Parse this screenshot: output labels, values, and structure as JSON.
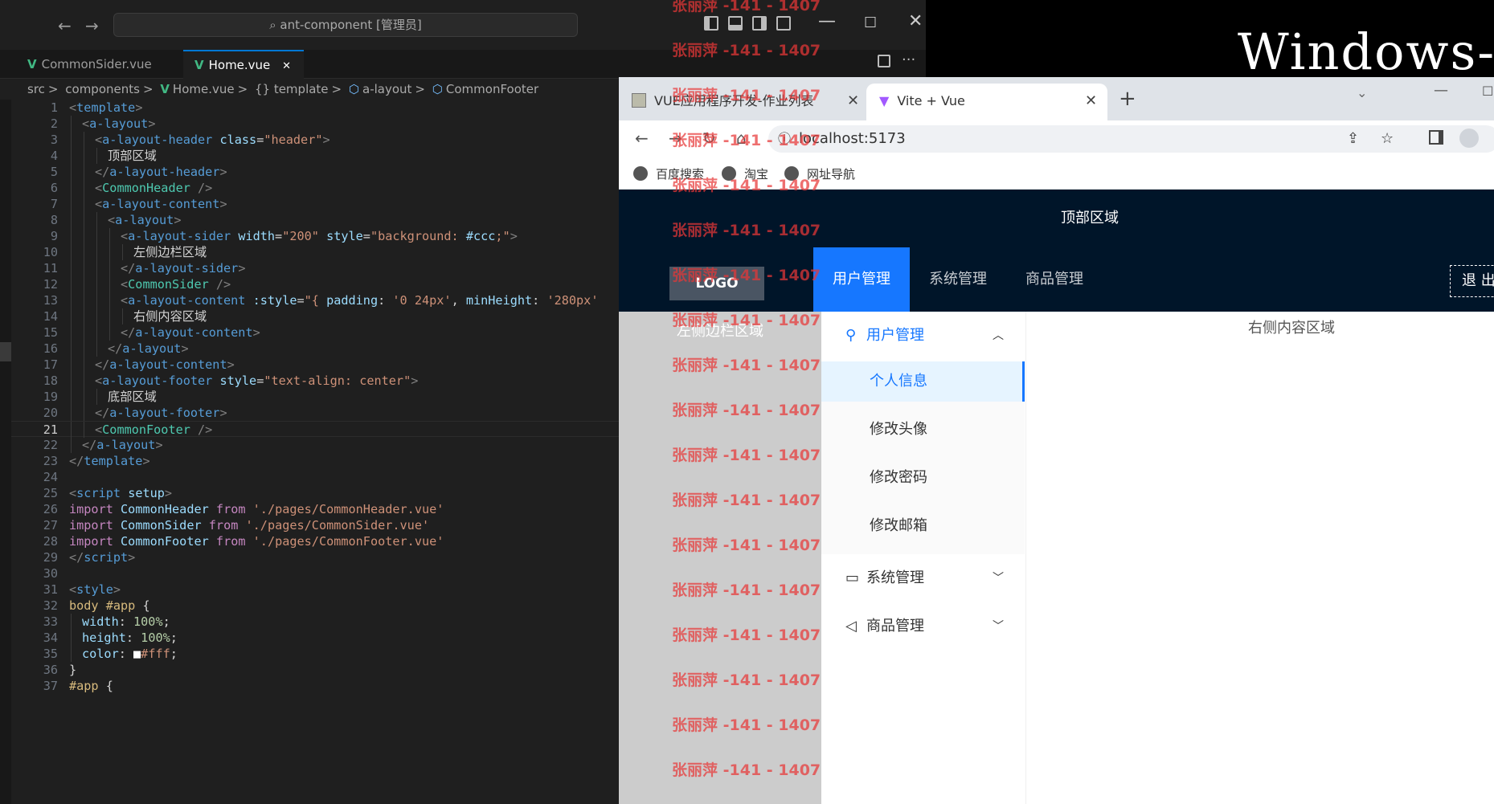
{
  "background": {
    "windows_text": "Windows-"
  },
  "vscode": {
    "search": "ant-component [管理员]",
    "tabs": [
      {
        "label": "CommonSider.vue",
        "active": false
      },
      {
        "label": "Home.vue",
        "active": true
      }
    ],
    "tab_close": "✕",
    "breadcrumb": [
      "src",
      "components",
      "Home.vue",
      "{} template",
      "a-layout",
      "CommonFooter"
    ],
    "breadcrumb_sep": ">",
    "current_line": 21,
    "lines": [
      {
        "n": "1",
        "indent": 0,
        "t": [
          [
            "t",
            "<"
          ],
          [
            "tag",
            "template"
          ],
          [
            "t",
            ">"
          ]
        ]
      },
      {
        "n": "2",
        "indent": 1,
        "t": [
          [
            "t",
            "<"
          ],
          [
            "tag",
            "a-layout"
          ],
          [
            "t",
            ">"
          ]
        ]
      },
      {
        "n": "3",
        "indent": 2,
        "t": [
          [
            "t",
            "<"
          ],
          [
            "tag",
            "a-layout-header"
          ],
          [
            "p",
            " "
          ],
          [
            "attr",
            "class"
          ],
          [
            "p",
            "="
          ],
          [
            "str",
            "\"header\""
          ],
          [
            "t",
            ">"
          ]
        ]
      },
      {
        "n": "4",
        "indent": 3,
        "t": [
          [
            "p",
            "顶部区域"
          ]
        ]
      },
      {
        "n": "5",
        "indent": 2,
        "t": [
          [
            "t",
            "</"
          ],
          [
            "tag",
            "a-layout-header"
          ],
          [
            "t",
            ">"
          ]
        ]
      },
      {
        "n": "6",
        "indent": 2,
        "t": [
          [
            "t",
            "<"
          ],
          [
            "comp",
            "CommonHeader"
          ],
          [
            "t",
            " />"
          ]
        ]
      },
      {
        "n": "7",
        "indent": 2,
        "t": [
          [
            "t",
            "<"
          ],
          [
            "tag",
            "a-layout-content"
          ],
          [
            "t",
            ">"
          ]
        ]
      },
      {
        "n": "8",
        "indent": 3,
        "t": [
          [
            "t",
            "<"
          ],
          [
            "tag",
            "a-layout"
          ],
          [
            "t",
            ">"
          ]
        ]
      },
      {
        "n": "9",
        "indent": 4,
        "t": [
          [
            "t",
            "<"
          ],
          [
            "tag",
            "a-layout-sider"
          ],
          [
            "p",
            " "
          ],
          [
            "attr",
            "width"
          ],
          [
            "p",
            "="
          ],
          [
            "str",
            "\"200\""
          ],
          [
            "p",
            " "
          ],
          [
            "attr",
            "style"
          ],
          [
            "p",
            "="
          ],
          [
            "str",
            "\"background: "
          ],
          [
            "attr",
            "#ccc"
          ],
          [
            "str",
            ";\""
          ],
          [
            "t",
            ">"
          ]
        ]
      },
      {
        "n": "10",
        "indent": 5,
        "t": [
          [
            "p",
            "左侧边栏区域"
          ]
        ]
      },
      {
        "n": "11",
        "indent": 4,
        "t": [
          [
            "t",
            "</"
          ],
          [
            "tag",
            "a-layout-sider"
          ],
          [
            "t",
            ">"
          ]
        ]
      },
      {
        "n": "12",
        "indent": 4,
        "t": [
          [
            "t",
            "<"
          ],
          [
            "comp",
            "CommonSider"
          ],
          [
            "t",
            " />"
          ]
        ]
      },
      {
        "n": "13",
        "indent": 4,
        "t": [
          [
            "t",
            "<"
          ],
          [
            "tag",
            "a-layout-content"
          ],
          [
            "p",
            " "
          ],
          [
            "attr",
            ":style"
          ],
          [
            "p",
            "="
          ],
          [
            "str",
            "\"{ "
          ],
          [
            "attr",
            "padding"
          ],
          [
            "p",
            ": "
          ],
          [
            "str",
            "'0 24px'"
          ],
          [
            "p",
            ", "
          ],
          [
            "attr",
            "minHeight"
          ],
          [
            "p",
            ": "
          ],
          [
            "str",
            "'280px'"
          ]
        ]
      },
      {
        "n": "14",
        "indent": 5,
        "t": [
          [
            "p",
            "右侧内容区域"
          ]
        ]
      },
      {
        "n": "15",
        "indent": 4,
        "t": [
          [
            "t",
            "</"
          ],
          [
            "tag",
            "a-layout-content"
          ],
          [
            "t",
            ">"
          ]
        ]
      },
      {
        "n": "16",
        "indent": 3,
        "t": [
          [
            "t",
            "</"
          ],
          [
            "tag",
            "a-layout"
          ],
          [
            "t",
            ">"
          ]
        ]
      },
      {
        "n": "17",
        "indent": 2,
        "t": [
          [
            "t",
            "</"
          ],
          [
            "tag",
            "a-layout-content"
          ],
          [
            "t",
            ">"
          ]
        ]
      },
      {
        "n": "18",
        "indent": 2,
        "t": [
          [
            "t",
            "<"
          ],
          [
            "tag",
            "a-layout-footer"
          ],
          [
            "p",
            " "
          ],
          [
            "attr",
            "style"
          ],
          [
            "p",
            "="
          ],
          [
            "str",
            "\"text-align: "
          ],
          [
            "str",
            "center\""
          ],
          [
            "t",
            ">"
          ]
        ]
      },
      {
        "n": "19",
        "indent": 3,
        "t": [
          [
            "p",
            "底部区域"
          ]
        ]
      },
      {
        "n": "20",
        "indent": 2,
        "t": [
          [
            "t",
            "</"
          ],
          [
            "tag",
            "a-layout-footer"
          ],
          [
            "t",
            ">"
          ]
        ]
      },
      {
        "n": "21",
        "indent": 2,
        "t": [
          [
            "t",
            "<"
          ],
          [
            "comp",
            "CommonFooter"
          ],
          [
            "t",
            " />"
          ]
        ]
      },
      {
        "n": "22",
        "indent": 1,
        "t": [
          [
            "t",
            "</"
          ],
          [
            "tag",
            "a-layout"
          ],
          [
            "t",
            ">"
          ]
        ]
      },
      {
        "n": "23",
        "indent": 0,
        "t": [
          [
            "t",
            "</"
          ],
          [
            "tag",
            "template"
          ],
          [
            "t",
            ">"
          ]
        ]
      },
      {
        "n": "24",
        "indent": 0,
        "t": []
      },
      {
        "n": "25",
        "indent": 0,
        "t": [
          [
            "t",
            "<"
          ],
          [
            "tag",
            "script"
          ],
          [
            "p",
            " "
          ],
          [
            "attr",
            "setup"
          ],
          [
            "t",
            ">"
          ]
        ]
      },
      {
        "n": "26",
        "indent": 0,
        "t": [
          [
            "kw",
            "import"
          ],
          [
            "p",
            " "
          ],
          [
            "id",
            "CommonHeader"
          ],
          [
            "p",
            " "
          ],
          [
            "kw",
            "from"
          ],
          [
            "p",
            " "
          ],
          [
            "str",
            "'./pages/CommonHeader.vue'"
          ]
        ]
      },
      {
        "n": "27",
        "indent": 0,
        "t": [
          [
            "kw",
            "import"
          ],
          [
            "p",
            " "
          ],
          [
            "id",
            "CommonSider"
          ],
          [
            "p",
            " "
          ],
          [
            "kw",
            "from"
          ],
          [
            "p",
            " "
          ],
          [
            "str",
            "'./pages/CommonSider.vue'"
          ]
        ]
      },
      {
        "n": "28",
        "indent": 0,
        "t": [
          [
            "kw",
            "import"
          ],
          [
            "p",
            " "
          ],
          [
            "id",
            "CommonFooter"
          ],
          [
            "p",
            " "
          ],
          [
            "kw",
            "from"
          ],
          [
            "p",
            " "
          ],
          [
            "str",
            "'./pages/CommonFooter.vue'"
          ]
        ]
      },
      {
        "n": "29",
        "indent": 0,
        "t": [
          [
            "t",
            "</"
          ],
          [
            "tag",
            "script"
          ],
          [
            "t",
            ">"
          ]
        ]
      },
      {
        "n": "30",
        "indent": 0,
        "t": []
      },
      {
        "n": "31",
        "indent": 0,
        "t": [
          [
            "t",
            "<"
          ],
          [
            "tag",
            "style"
          ],
          [
            "t",
            ">"
          ]
        ]
      },
      {
        "n": "32",
        "indent": 0,
        "t": [
          [
            "sel",
            "body #app"
          ],
          [
            "p",
            " "
          ],
          [
            "brace",
            "{"
          ]
        ]
      },
      {
        "n": "33",
        "indent": 1,
        "t": [
          [
            "prop",
            "width"
          ],
          [
            "p",
            ": "
          ],
          [
            "num",
            "100%"
          ],
          [
            "p",
            ";"
          ]
        ]
      },
      {
        "n": "34",
        "indent": 1,
        "t": [
          [
            "prop",
            "height"
          ],
          [
            "p",
            ": "
          ],
          [
            "num",
            "100%"
          ],
          [
            "p",
            ";"
          ]
        ]
      },
      {
        "n": "35",
        "indent": 1,
        "t": [
          [
            "prop",
            "color"
          ],
          [
            "p",
            ": "
          ],
          [
            "swatch",
            "■"
          ],
          [
            "str",
            "#fff"
          ],
          [
            "p",
            ";"
          ]
        ]
      },
      {
        "n": "36",
        "indent": 0,
        "t": [
          [
            "brace",
            "}"
          ]
        ]
      },
      {
        "n": "37",
        "indent": 0,
        "t": [
          [
            "sel",
            "#app"
          ],
          [
            "p",
            " "
          ],
          [
            "brace",
            "{"
          ]
        ]
      }
    ]
  },
  "browser": {
    "tabs": [
      {
        "label": "VUE应用程序开发-作业列表",
        "active": false
      },
      {
        "label": "Vite + Vue",
        "active": true
      }
    ],
    "tab_close": "✕",
    "new_tab": "+",
    "address": "localhost:5173",
    "bookmarks": [
      "百度搜索",
      "淘宝",
      "网址导航"
    ]
  },
  "page": {
    "header_text": "顶部区域",
    "logo": "LOGO",
    "nav_items": [
      {
        "label": "用户管理",
        "active": true
      },
      {
        "label": "系统管理",
        "active": false
      },
      {
        "label": "商品管理",
        "active": false
      }
    ],
    "logout": "退 出",
    "sider_label": "左侧边栏区域",
    "content_label": "右侧内容区域",
    "menu": {
      "user_mgmt": "用户管理",
      "user_items": [
        "个人信息",
        "修改头像",
        "修改密码",
        "修改邮箱"
      ],
      "system_mgmt": "系统管理",
      "product_mgmt": "商品管理"
    }
  },
  "watermark": "张丽萍 -141 - 1407",
  "colors": {
    "vs_bg": "#1f1f1f",
    "tag": "#569cd6",
    "bracket": "#808080",
    "attr": "#9cdcfe",
    "string": "#ce9178",
    "component": "#4ec9b0",
    "keyword": "#c586c0",
    "identifier": "#9cdcfe",
    "selector": "#d7ba7d",
    "number": "#b5cea8",
    "header_bg": "#001529",
    "primary": "#1677ff",
    "watermark": "#e83838"
  }
}
